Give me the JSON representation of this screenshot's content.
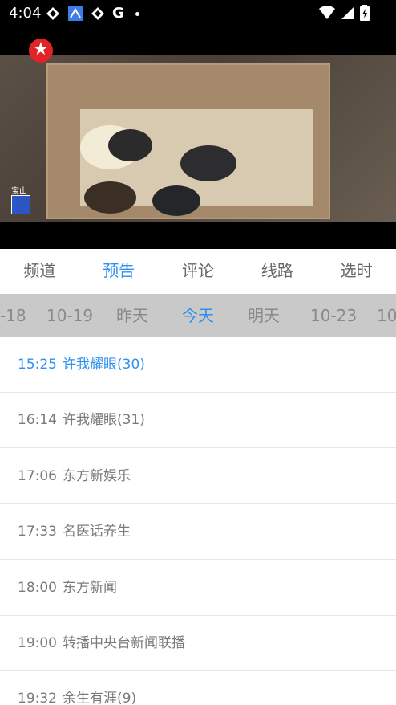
{
  "status_bar": {
    "time": "4:04",
    "icons": [
      "notification-icon",
      "maps-icon",
      "notification-icon",
      "google-icon",
      "dot-icon"
    ],
    "right_icons": [
      "wifi-icon",
      "signal-icon",
      "battery-icon"
    ],
    "google_glyph": "G"
  },
  "video": {
    "channel_logo": "dragon-tv-logo",
    "overlay_text": "宝山"
  },
  "tabs": [
    {
      "label": "频道",
      "active": false
    },
    {
      "label": "预告",
      "active": true
    },
    {
      "label": "评论",
      "active": false
    },
    {
      "label": "线路",
      "active": false
    },
    {
      "label": "选时",
      "active": false
    }
  ],
  "dates": [
    {
      "label": "-18",
      "active": false
    },
    {
      "label": "10-19",
      "active": false
    },
    {
      "label": "昨天",
      "active": false
    },
    {
      "label": "今天",
      "active": true
    },
    {
      "label": "明天",
      "active": false
    },
    {
      "label": "10-23",
      "active": false
    },
    {
      "label": "10-",
      "active": false
    }
  ],
  "programs": [
    {
      "time": "15:25",
      "title": "许我耀眼(30)",
      "active": true
    },
    {
      "time": "16:14",
      "title": "许我耀眼(31)",
      "active": false
    },
    {
      "time": "17:06",
      "title": "东方新娱乐",
      "active": false
    },
    {
      "time": "17:33",
      "title": "名医话养生",
      "active": false
    },
    {
      "time": "18:00",
      "title": "东方新闻",
      "active": false
    },
    {
      "time": "19:00",
      "title": "转播中央台新闻联播",
      "active": false
    },
    {
      "time": "19:32",
      "title": "余生有涯(9)",
      "active": false
    }
  ],
  "colors": {
    "accent": "#2d8ff0",
    "date_bar": "#c9c9c9",
    "inactive_text": "#7a7a7a"
  }
}
